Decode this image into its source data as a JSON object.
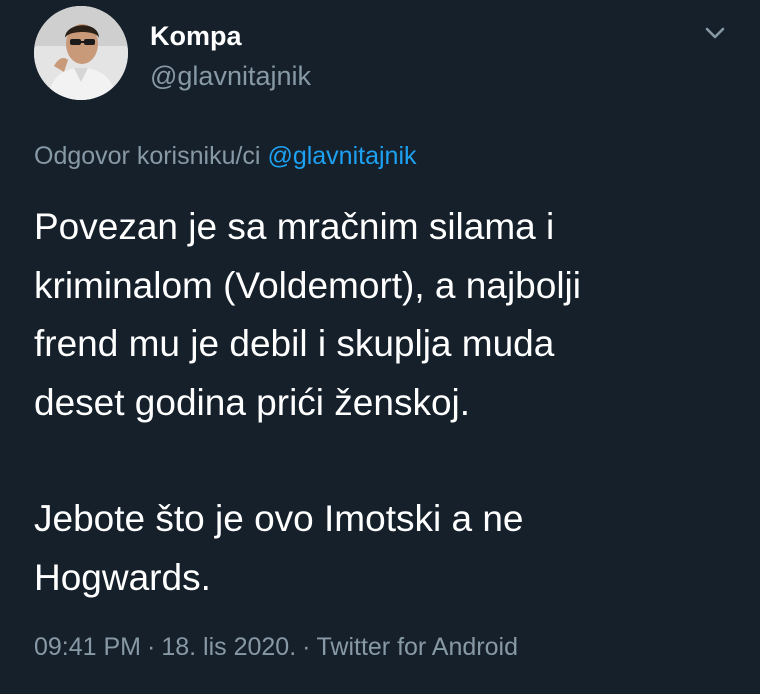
{
  "tweet": {
    "author": {
      "display_name": "Kompa",
      "handle": "@glavnitajnik",
      "avatar_icon": "avatar-photo"
    },
    "menu_icon": "chevron-down-icon",
    "reply": {
      "prefix": "Odgovor korisniku/ci",
      "mention": "@glavnitajnik"
    },
    "body": {
      "paragraph1": [
        "Povezan je sa mračnim silama i",
        "kriminalom (Voldemort), a najbolji",
        "frend mu je debil i skuplja muda",
        "deset godina prići ženskoj."
      ],
      "paragraph2": [
        "Jebote što je ovo Imotski a ne",
        "Hogwards."
      ]
    },
    "meta": {
      "time": "09:41 PM",
      "date": "18. lis 2020.",
      "separator": "·",
      "source": "Twitter for Android"
    }
  },
  "colors": {
    "background": "#15202b",
    "primary_text": "#ffffff",
    "secondary_text": "#8899a6",
    "link": "#1da1f2"
  }
}
